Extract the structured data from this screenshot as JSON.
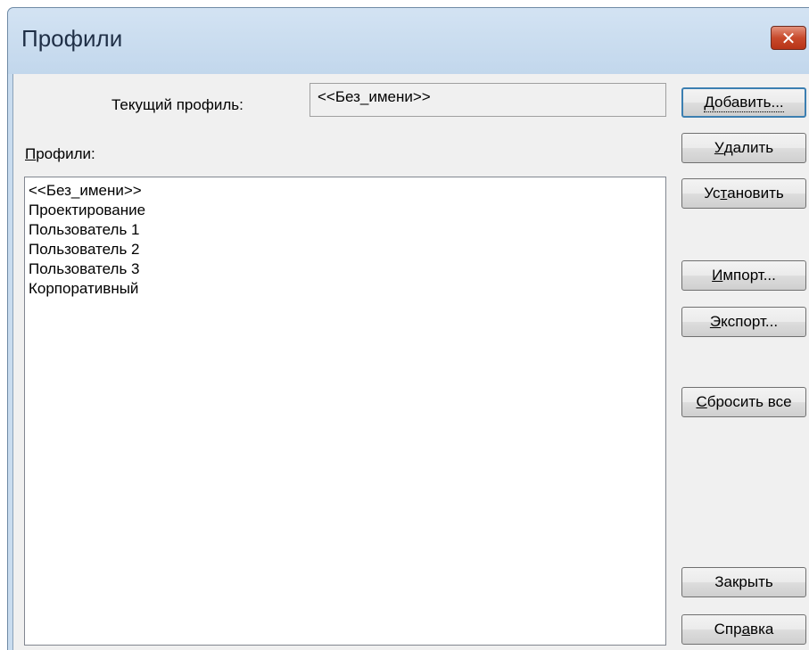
{
  "window": {
    "title": "Профили"
  },
  "current_profile": {
    "label": "Текущий профиль:",
    "value": "<<Без_имени>>"
  },
  "profiles": {
    "label_key": "П",
    "label_rest": "рофили:",
    "items": [
      "<<Без_имени>>",
      "Проектирование",
      "Пользователь 1",
      "Пользователь 2",
      "Пользователь 3",
      "Корпоративный"
    ]
  },
  "buttons": {
    "add": {
      "pre": "",
      "key": "Д",
      "post": "обавить..."
    },
    "delete": {
      "pre": "",
      "key": "У",
      "post": "далить"
    },
    "set": {
      "pre": "Ус",
      "key": "т",
      "post": "ановить"
    },
    "import": {
      "pre": "",
      "key": "И",
      "post": "мпорт..."
    },
    "export": {
      "pre": "",
      "key": "Э",
      "post": "кспорт..."
    },
    "reset": {
      "pre": "",
      "key": "С",
      "post": "бросить все"
    },
    "close": {
      "label": "Закрыть"
    },
    "help": {
      "pre": "Спр",
      "key": "а",
      "post": "вка"
    }
  },
  "colors": {
    "frame": "#c9dcef",
    "client": "#f0f0f0",
    "close_button": "#c84a2c"
  }
}
